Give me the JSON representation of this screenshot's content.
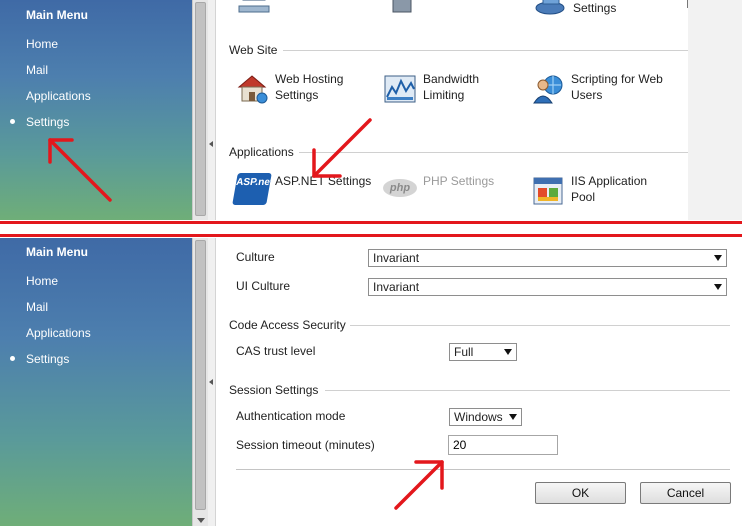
{
  "sidebar": {
    "title": "Main Menu",
    "items": [
      {
        "label": "Home"
      },
      {
        "label": "Mail"
      },
      {
        "label": "Applications"
      },
      {
        "label": "Settings",
        "selected": true
      }
    ]
  },
  "top": {
    "partial_row": [
      {
        "label": "",
        "icon": "network-icon"
      },
      {
        "label": "",
        "icon": "tools-icon"
      },
      {
        "label": "Settings",
        "icon": "disk-settings-icon"
      }
    ],
    "groups": [
      {
        "title": "Web Site",
        "features": [
          {
            "label": "Web Hosting\nSettings",
            "icon": "web-hosting-icon"
          },
          {
            "label": "Bandwidth\nLimiting",
            "icon": "bandwidth-chart-icon"
          },
          {
            "label": "Scripting for Web\nUsers",
            "icon": "user-globe-icon"
          }
        ]
      },
      {
        "title": "Applications",
        "features": [
          {
            "label": "ASP.NET Settings",
            "icon": "aspnet-logo-icon",
            "icon_text": "ASP.net"
          },
          {
            "label": "PHP Settings",
            "icon": "php-logo-icon",
            "icon_text": "php",
            "disabled": true
          },
          {
            "label": "IIS Application\nPool",
            "icon": "iis-window-icon"
          }
        ]
      }
    ]
  },
  "bottom": {
    "culture": {
      "label": "Culture",
      "value": "Invariant"
    },
    "ui_culture": {
      "label": "UI Culture",
      "value": "Invariant"
    },
    "code_access_security": {
      "title": "Code Access Security",
      "trust_label": "CAS trust level",
      "trust_value": "Full"
    },
    "session_settings": {
      "title": "Session Settings",
      "auth_label": "Authentication mode",
      "auth_value": "Windows",
      "timeout_label": "Session timeout (minutes)",
      "timeout_value": "20"
    },
    "buttons": {
      "ok": "OK",
      "cancel": "Cancel"
    }
  },
  "colors": {
    "sidebar_top": "#3f6aa6",
    "sidebar_bottom": "#6fae78",
    "annotation": "#e3171c"
  }
}
